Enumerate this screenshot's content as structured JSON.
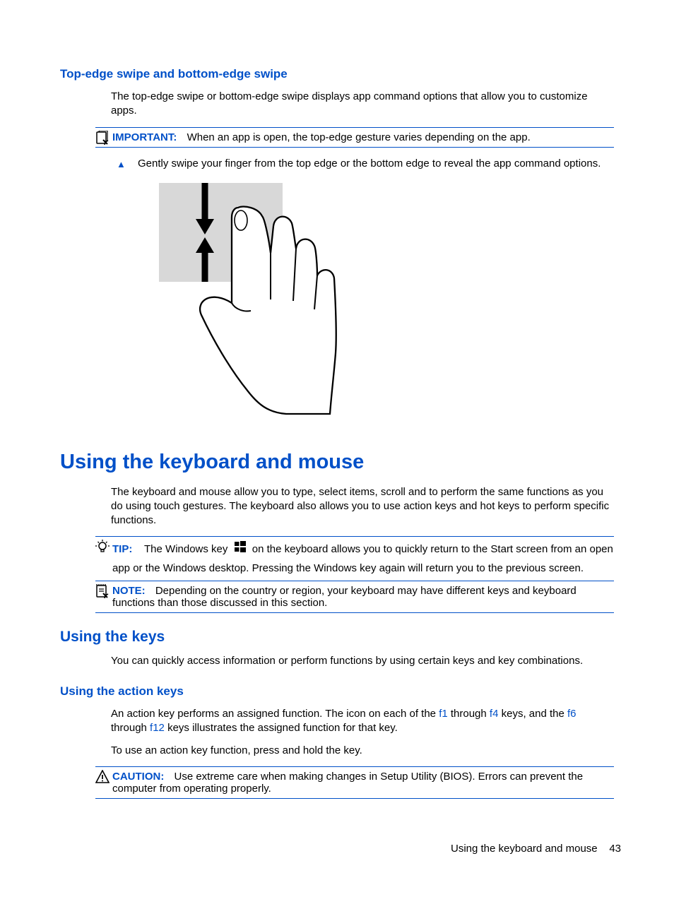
{
  "section1": {
    "heading": "Top-edge swipe and bottom-edge swipe",
    "intro": "The top-edge swipe or bottom-edge swipe displays app command options that allow you to customize apps.",
    "important": {
      "label": "IMPORTANT:",
      "text": "When an app is open, the top-edge gesture varies depending on the app."
    },
    "step": "Gently swipe your finger from the top edge or the bottom edge to reveal the app command options."
  },
  "section2": {
    "heading": "Using the keyboard and mouse",
    "intro": "The keyboard and mouse allow you to type, select items, scroll and to perform the same functions as you do using touch gestures. The keyboard also allows you to use action keys and hot keys to perform specific functions.",
    "tip": {
      "label": "TIP:",
      "text_before": "The Windows key",
      "text_after": "on the keyboard allows you to quickly return to the Start screen from an open app or the Windows desktop. Pressing the Windows key again will return you to the previous screen."
    },
    "note": {
      "label": "NOTE:",
      "text": "Depending on the country or region, your keyboard may have different keys and keyboard functions than those discussed in this section."
    }
  },
  "section3": {
    "heading": "Using the keys",
    "intro": "You can quickly access information or perform functions by using certain keys and key combinations."
  },
  "section4": {
    "heading": "Using the action keys",
    "para1_a": "An action key performs an assigned function. The icon on each of the ",
    "f1": "f1",
    "para1_b": " through ",
    "f4": "f4",
    "para1_c": " keys, and the ",
    "f6": "f6",
    "para1_d": " through ",
    "f12": "f12",
    "para1_e": " keys illustrates the assigned function for that key.",
    "para2": "To use an action key function, press and hold the key.",
    "caution": {
      "label": "CAUTION:",
      "text": "Use extreme care when making changes in Setup Utility (BIOS). Errors can prevent the computer from operating properly."
    }
  },
  "footer": {
    "title": "Using the keyboard and mouse",
    "page": "43"
  }
}
